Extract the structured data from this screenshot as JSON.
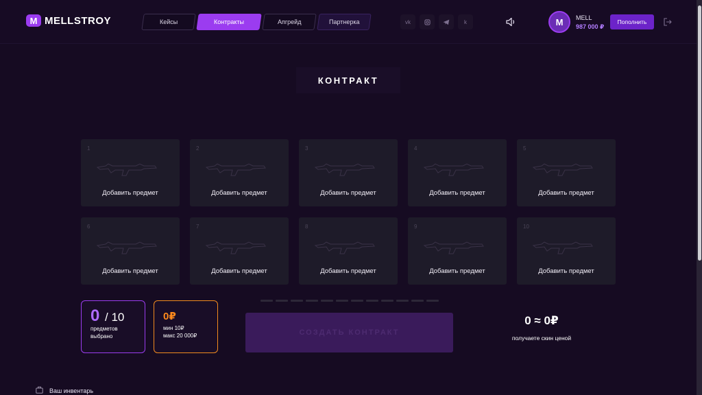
{
  "header": {
    "logo_mark": "M",
    "logo_text": "MELLSTROY",
    "nav": [
      "Кейсы",
      "Контракты",
      "Апгрейд",
      "Партнерка"
    ],
    "active_tab": "Контракты",
    "socials": [
      "vk-icon",
      "instagram-icon",
      "telegram-icon",
      "k-icon"
    ],
    "user": {
      "avatar_mark": "M",
      "name": "MELL",
      "balance": "987 000 ₽"
    },
    "topup_label": "Пополнить"
  },
  "page": {
    "title": "КОНТРАКТ"
  },
  "slots": [
    {
      "num": "1",
      "label": "Добавить предмет"
    },
    {
      "num": "2",
      "label": "Добавить предмет"
    },
    {
      "num": "3",
      "label": "Добавить предмет"
    },
    {
      "num": "4",
      "label": "Добавить предмет"
    },
    {
      "num": "5",
      "label": "Добавить предмет"
    },
    {
      "num": "6",
      "label": "Добавить предмет"
    },
    {
      "num": "7",
      "label": "Добавить предмет"
    },
    {
      "num": "8",
      "label": "Добавить предмет"
    },
    {
      "num": "9",
      "label": "Добавить предмет"
    },
    {
      "num": "10",
      "label": "Добавить предмет"
    }
  ],
  "selection": {
    "count": "0",
    "max": "/ 10",
    "label": "предметов выбрано"
  },
  "price": {
    "value": "0₽",
    "min": "мин 10₽",
    "max": "макс 20 000₽"
  },
  "progress": {
    "filled": 0,
    "total": 12
  },
  "create_label": "СОЗДАТЬ КОНТРАКТ",
  "result": {
    "equation": "0 ≈ 0₽",
    "caption": "получаете скин ценой"
  },
  "inventory_label": "Ваш инвентарь",
  "colors": {
    "accent": "#9b3cf0",
    "price": "#ff8a1c",
    "background": "#160b22",
    "slot": "#1e1b29"
  }
}
